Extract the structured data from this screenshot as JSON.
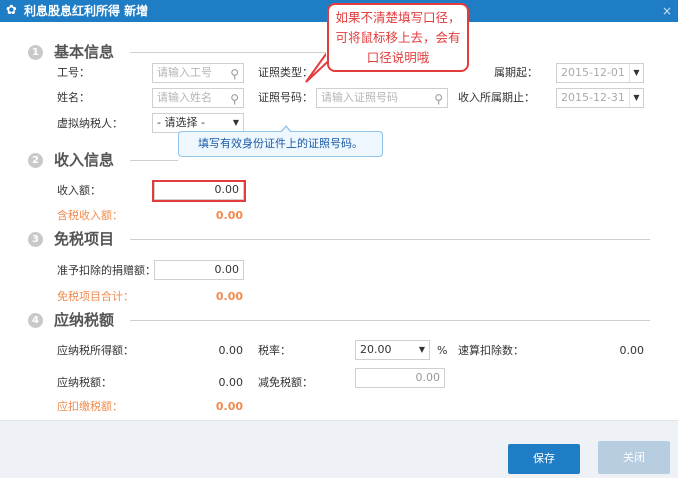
{
  "window": {
    "title": "利息股息红利所得 新增",
    "gear_icon": "gear-icon",
    "close_glyph": "×"
  },
  "sections": {
    "basic": {
      "num": "1",
      "title": "基本信息"
    },
    "income": {
      "num": "2",
      "title": "收入信息"
    },
    "exempt": {
      "num": "3",
      "title": "免税项目"
    },
    "tax": {
      "num": "4",
      "title": "应纳税额"
    }
  },
  "basic": {
    "employee_id_label": "工号：",
    "employee_id_placeholder": "请输入工号",
    "name_label": "姓名：",
    "name_placeholder": "请输入姓名",
    "virtual_taxpayer_label": "虚拟纳税人：",
    "virtual_taxpayer_value": "- 请选择 -",
    "id_type_label": "证照类型：",
    "id_number_label": "证照号码：",
    "id_number_placeholder": "请输入证照号码",
    "period_start_label": "属期起：",
    "period_start_value": "2015-12-01",
    "period_end_label": "收入所属期止：",
    "period_end_value": "2015-12-31"
  },
  "income": {
    "amount_label": "收入额：",
    "amount_value": "0.00",
    "taxable_income_label": "含税收入额：",
    "taxable_income_value": "0.00"
  },
  "exempt": {
    "donation_label": "准予扣除的捐赠额：",
    "donation_value": "0.00",
    "total_label": "免税项目合计：",
    "total_value": "0.00"
  },
  "tax": {
    "taxable_amount_label": "应纳税所得额：",
    "taxable_amount_value": "0.00",
    "rate_label": "税率：",
    "rate_value": "20.00",
    "rate_unit": "%",
    "quick_deduction_label": "速算扣除数：",
    "quick_deduction_value": "0.00",
    "tax_payable_label": "应纳税额：",
    "tax_payable_value": "0.00",
    "reduction_label": "减免税额：",
    "reduction_value": "0.00",
    "withholding_label": "应扣缴税额：",
    "withholding_value": "0.00"
  },
  "tooltip": {
    "text": "填写有效身份证件上的证照号码。"
  },
  "callout": {
    "text": "如果不清楚填写口径，可将鼠标移上去，会有口径说明哦"
  },
  "footer": {
    "save_label": "保存",
    "close_label": "关闭"
  },
  "colors": {
    "titlebar": "#1f7dc6",
    "accent_orange": "#f08b4e",
    "callout_red": "#e33c3c",
    "save_button": "#1f7dc6",
    "close_button": "#b7cde0"
  }
}
